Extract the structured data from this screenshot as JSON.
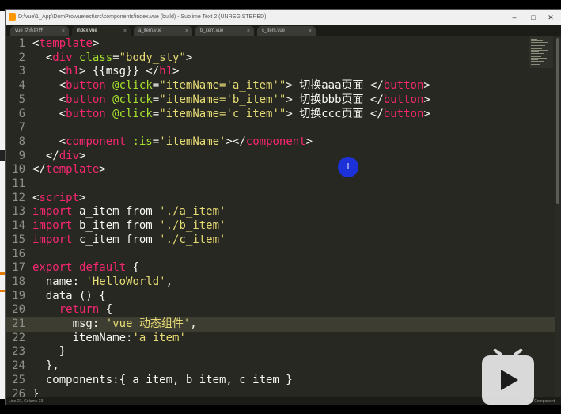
{
  "window": {
    "title": "D:\\vue\\1_App\\DomPro\\vuetest\\src\\components\\index.vue (build) - Sublime Text 2 (UNREGISTERED)",
    "controls": {
      "minimize": "–",
      "maximize": "□",
      "close": "✕"
    }
  },
  "tabs": [
    {
      "label": "vue 动态组件",
      "active": false
    },
    {
      "label": "index.vue",
      "active": true
    },
    {
      "label": "a_item.vue",
      "active": false
    },
    {
      "label": "b_item.vue",
      "active": false
    },
    {
      "label": "c_item.vue",
      "active": false
    }
  ],
  "tab_close": "×",
  "editor": {
    "current_line": 21,
    "lines": [
      {
        "n": "1",
        "tokens": [
          [
            "t-plain",
            "<"
          ],
          [
            "t-tag",
            "template"
          ],
          [
            "t-plain",
            ">"
          ]
        ]
      },
      {
        "n": "2",
        "tokens": [
          [
            "t-plain",
            "  <"
          ],
          [
            "t-tag",
            "div"
          ],
          [
            "t-plain",
            " "
          ],
          [
            "t-attr",
            "class"
          ],
          [
            "t-plain",
            "="
          ],
          [
            "t-str",
            "\"body_sty\""
          ],
          [
            "t-plain",
            ">"
          ]
        ]
      },
      {
        "n": "3",
        "tokens": [
          [
            "t-plain",
            "    <"
          ],
          [
            "t-tag",
            "h1"
          ],
          [
            "t-plain",
            "> {{msg}} </"
          ],
          [
            "t-tag",
            "h1"
          ],
          [
            "t-plain",
            ">"
          ]
        ]
      },
      {
        "n": "4",
        "tokens": [
          [
            "t-plain",
            "    <"
          ],
          [
            "t-tag",
            "button"
          ],
          [
            "t-plain",
            " "
          ],
          [
            "t-attr",
            "@click"
          ],
          [
            "t-plain",
            "="
          ],
          [
            "t-str",
            "\"itemName="
          ],
          [
            "t-str",
            "'a_item'"
          ],
          [
            "t-str",
            "\""
          ],
          [
            "t-plain",
            "> 切换aaa页面 </"
          ],
          [
            "t-tag",
            "button"
          ],
          [
            "t-plain",
            ">"
          ]
        ]
      },
      {
        "n": "5",
        "tokens": [
          [
            "t-plain",
            "    <"
          ],
          [
            "t-tag",
            "button"
          ],
          [
            "t-plain",
            " "
          ],
          [
            "t-attr",
            "@click"
          ],
          [
            "t-plain",
            "="
          ],
          [
            "t-str",
            "\"itemName="
          ],
          [
            "t-str",
            "'b_item'"
          ],
          [
            "t-str",
            "\""
          ],
          [
            "t-plain",
            "> 切换bbb页面 </"
          ],
          [
            "t-tag",
            "button"
          ],
          [
            "t-plain",
            ">"
          ]
        ]
      },
      {
        "n": "6",
        "tokens": [
          [
            "t-plain",
            "    <"
          ],
          [
            "t-tag",
            "button"
          ],
          [
            "t-plain",
            " "
          ],
          [
            "t-attr",
            "@click"
          ],
          [
            "t-plain",
            "="
          ],
          [
            "t-str",
            "\"itemName="
          ],
          [
            "t-str",
            "'c_item'"
          ],
          [
            "t-str",
            "\""
          ],
          [
            "t-plain",
            "> 切换ccc页面 </"
          ],
          [
            "t-tag",
            "button"
          ],
          [
            "t-plain",
            ">"
          ]
        ]
      },
      {
        "n": "7",
        "tokens": [
          [
            "t-plain",
            ""
          ]
        ]
      },
      {
        "n": "8",
        "tokens": [
          [
            "t-plain",
            "    <"
          ],
          [
            "t-tag",
            "component"
          ],
          [
            "t-plain",
            " "
          ],
          [
            "t-attr",
            ":is"
          ],
          [
            "t-plain",
            "="
          ],
          [
            "t-str",
            "'itemName'"
          ],
          [
            "t-plain",
            "></"
          ],
          [
            "t-tag",
            "component"
          ],
          [
            "t-plain",
            ">"
          ]
        ]
      },
      {
        "n": "9",
        "tokens": [
          [
            "t-plain",
            "  </"
          ],
          [
            "t-tag",
            "div"
          ],
          [
            "t-plain",
            ">"
          ]
        ]
      },
      {
        "n": "10",
        "tokens": [
          [
            "t-plain",
            "</"
          ],
          [
            "t-tag",
            "template"
          ],
          [
            "t-plain",
            ">"
          ]
        ]
      },
      {
        "n": "11",
        "tokens": [
          [
            "t-plain",
            ""
          ]
        ]
      },
      {
        "n": "12",
        "tokens": [
          [
            "t-plain",
            "<"
          ],
          [
            "t-tag",
            "script"
          ],
          [
            "t-plain",
            ">"
          ]
        ]
      },
      {
        "n": "13",
        "tokens": [
          [
            "t-kw",
            "import"
          ],
          [
            "t-plain",
            " a_item "
          ],
          [
            "t-plain",
            "from"
          ],
          [
            "t-plain",
            " "
          ],
          [
            "t-str",
            "'./a_item'"
          ]
        ]
      },
      {
        "n": "14",
        "tokens": [
          [
            "t-kw",
            "import"
          ],
          [
            "t-plain",
            " b_item "
          ],
          [
            "t-plain",
            "from"
          ],
          [
            "t-plain",
            " "
          ],
          [
            "t-str",
            "'./b_item'"
          ]
        ]
      },
      {
        "n": "15",
        "tokens": [
          [
            "t-kw",
            "import"
          ],
          [
            "t-plain",
            " c_item "
          ],
          [
            "t-plain",
            "from"
          ],
          [
            "t-plain",
            " "
          ],
          [
            "t-str",
            "'./c_item'"
          ]
        ]
      },
      {
        "n": "16",
        "tokens": [
          [
            "t-plain",
            ""
          ]
        ]
      },
      {
        "n": "17",
        "tokens": [
          [
            "t-kw",
            "export"
          ],
          [
            "t-plain",
            " "
          ],
          [
            "t-kw",
            "default"
          ],
          [
            "t-plain",
            " {"
          ]
        ]
      },
      {
        "n": "18",
        "tokens": [
          [
            "t-plain",
            "  name: "
          ],
          [
            "t-str",
            "'HelloWorld'"
          ],
          [
            "t-plain",
            ","
          ]
        ]
      },
      {
        "n": "19",
        "tokens": [
          [
            "t-plain",
            "  data () {"
          ]
        ]
      },
      {
        "n": "20",
        "tokens": [
          [
            "t-plain",
            "    "
          ],
          [
            "t-kw",
            "return"
          ],
          [
            "t-plain",
            " {"
          ]
        ]
      },
      {
        "n": "21",
        "tokens": [
          [
            "t-plain",
            "      msg: "
          ],
          [
            "t-str",
            "'vue 动态组件'"
          ],
          [
            "t-plain",
            ","
          ]
        ]
      },
      {
        "n": "22",
        "tokens": [
          [
            "t-plain",
            "      itemName:"
          ],
          [
            "t-str",
            "'a_item'"
          ]
        ]
      },
      {
        "n": "23",
        "tokens": [
          [
            "t-plain",
            "    }"
          ]
        ]
      },
      {
        "n": "24",
        "tokens": [
          [
            "t-plain",
            "  },"
          ]
        ]
      },
      {
        "n": "25",
        "tokens": [
          [
            "t-plain",
            "  components:{ a_item, b_item, c_item }"
          ]
        ]
      },
      {
        "n": "26",
        "tokens": [
          [
            "t-plain",
            "}"
          ]
        ]
      }
    ]
  },
  "status": {
    "left": "Line 21, Column 23",
    "right": "Vue Component"
  },
  "cursor_glyph": "I"
}
